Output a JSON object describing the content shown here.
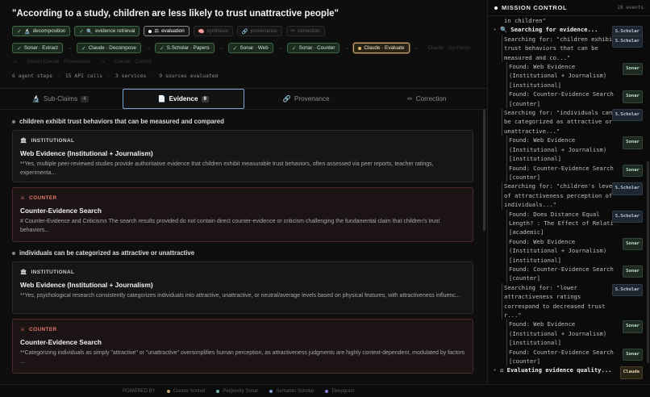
{
  "claim": "\"According to a study, children are less likely to trust unattractive people\"",
  "phase_chips": [
    {
      "label": "decomposition",
      "state": "done",
      "icon": "🔬"
    },
    {
      "label": "evidence retrieval",
      "state": "done",
      "icon": "🔍"
    },
    {
      "label": "evaluation",
      "state": "active",
      "icon": "⚖"
    },
    {
      "label": "synthesis",
      "state": "pending",
      "icon": "🧠"
    },
    {
      "label": "provenance",
      "state": "pending",
      "icon": "🔗"
    },
    {
      "label": "correction",
      "state": "pending",
      "icon": "✏"
    }
  ],
  "pipeline": [
    {
      "label": "Sonar · Extract",
      "state": "done"
    },
    {
      "label": "Claude · Decompose",
      "state": "done"
    },
    {
      "label": "S.Scholar · Papers",
      "state": "done"
    },
    {
      "label": "Sonar · Web",
      "state": "done"
    },
    {
      "label": "Sonar · Counter",
      "state": "done"
    },
    {
      "label": "Claude · Evaluate",
      "state": "current"
    },
    {
      "label": "Claude · Synthesis",
      "state": "faded"
    },
    {
      "label": "Sonar+Claude · Provenance",
      "state": "faded"
    },
    {
      "label": "Claude · Correct",
      "state": "faded"
    }
  ],
  "stats": [
    "6 agent steps",
    "15 API calls",
    "3 services",
    "9 sources evaluated"
  ],
  "tabs": [
    {
      "label": "Sub-Claims",
      "badge": "4",
      "icon": "🔬"
    },
    {
      "label": "Evidence",
      "badge": "9",
      "icon": "📄"
    },
    {
      "label": "Provenance",
      "badge": "",
      "icon": "🔗"
    },
    {
      "label": "Correction",
      "badge": "",
      "icon": "✏"
    }
  ],
  "evidence_groups": [
    {
      "subclaim": "children exhibit trust behaviors that can be measured and compared",
      "cards": [
        {
          "kind": "INSTITUTIONAL",
          "type": "inst",
          "title": "Web Evidence (Institutional + Journalism)",
          "body": "**Yes, multiple peer-reviewed studies provide authoritative evidence that children exhibit measurable trust behaviors, often assessed via peer reports, teacher ratings, experimenta..."
        },
        {
          "kind": "COUNTER",
          "type": "ctr",
          "title": "Counter-Evidence Search",
          "body": "# Counter-Evidence and Criticisms The search results provided do not contain direct counter-evidence or criticism challenging the fundamental claim that children's trust behaviors..."
        }
      ]
    },
    {
      "subclaim": "individuals can be categorized as attractive or unattractive",
      "cards": [
        {
          "kind": "INSTITUTIONAL",
          "type": "inst",
          "title": "Web Evidence (Institutional + Journalism)",
          "body": "**Yes, psychological research consistently categorizes individuals into attractive, unattractive, or neutral/average levels based on physical features, with attractiveness influenc..."
        },
        {
          "kind": "COUNTER",
          "type": "ctr",
          "title": "Counter-Evidence Search",
          "body": "**Categorizing individuals as simply \"attractive\" or \"unattractive\" oversimplifies human perception, as attractiveness judgments are highly context-dependent, modulated by factors ..."
        }
      ]
    }
  ],
  "footer": {
    "label": "POWERED BY",
    "services": [
      {
        "name": "Claude Sonnet",
        "color": "#c9a46a"
      },
      {
        "name": "Perplexity Sonar",
        "color": "#6fb3a8"
      },
      {
        "name": "Semantic Scholar",
        "color": "#7d9fd0"
      },
      {
        "name": "Deepgram",
        "color": "#8a7fd6"
      }
    ]
  },
  "mission": {
    "title": "MISSION CONTROL",
    "count": "28 events",
    "log": [
      {
        "type": "text",
        "indent": 1,
        "text": "in children\""
      },
      {
        "type": "head",
        "indent": 0,
        "icon": "🔍",
        "text": "Searching for evidence...",
        "tag": "S.Scholar",
        "tagType": "scholar"
      },
      {
        "type": "search",
        "indent": 1,
        "text": "Searching for: \"children exhibit\ntrust behaviors that can be\nmeasured and co...\"",
        "tag": "S.Scholar",
        "tagType": "scholar"
      },
      {
        "type": "found",
        "indent": 2,
        "text": "Found: Web Evidence\n(Institutional + Journalism)\n[institutional]",
        "tag": "Sonar",
        "tagType": "sonar"
      },
      {
        "type": "found",
        "indent": 2,
        "text": "Found: Counter-Evidence Search\n[counter]",
        "tag": "Sonar",
        "tagType": "sonar"
      },
      {
        "type": "search",
        "indent": 1,
        "text": "Searching for: \"individuals can\nbe categorized as attractive or\nunattractive...\"",
        "tag": "S.Scholar",
        "tagType": "scholar"
      },
      {
        "type": "found",
        "indent": 2,
        "text": "Found: Web Evidence\n(Institutional + Journalism)\n[institutional]",
        "tag": "Sonar",
        "tagType": "sonar"
      },
      {
        "type": "found",
        "indent": 2,
        "text": "Found: Counter-Evidence Search\n[counter]",
        "tag": "Sonar",
        "tagType": "sonar"
      },
      {
        "type": "search",
        "indent": 1,
        "text": "Searching for: \"children's level\nof attractiveness perception of\nindividuals...\"",
        "tag": "S.Scholar",
        "tagType": "scholar"
      },
      {
        "type": "found",
        "indent": 2,
        "text": "Found: Does Distance Equal\nLength? : The Effect of Relati\n[academic]",
        "tag": "S.Scholar",
        "tagType": "scholar"
      },
      {
        "type": "found",
        "indent": 2,
        "text": "Found: Web Evidence\n(Institutional + Journalism)\n[institutional]",
        "tag": "Sonar",
        "tagType": "sonar"
      },
      {
        "type": "found",
        "indent": 2,
        "text": "Found: Counter-Evidence Search\n[counter]",
        "tag": "Sonar",
        "tagType": "sonar"
      },
      {
        "type": "search",
        "indent": 1,
        "text": "Searching for: \"lower\nattractiveness ratings\ncorrespond to decreased trust\nr...\"",
        "tag": "S.Scholar",
        "tagType": "scholar"
      },
      {
        "type": "found",
        "indent": 2,
        "text": "Found: Web Evidence\n(Institutional + Journalism)\n[institutional]",
        "tag": "Sonar",
        "tagType": "sonar"
      },
      {
        "type": "found",
        "indent": 2,
        "text": "Found: Counter-Evidence Search\n[counter]",
        "tag": "Sonar",
        "tagType": "sonar"
      },
      {
        "type": "head",
        "indent": 0,
        "icon": "⚖",
        "text": "Evaluating evidence quality...",
        "tag": "Claude",
        "tagType": "claude"
      }
    ]
  }
}
